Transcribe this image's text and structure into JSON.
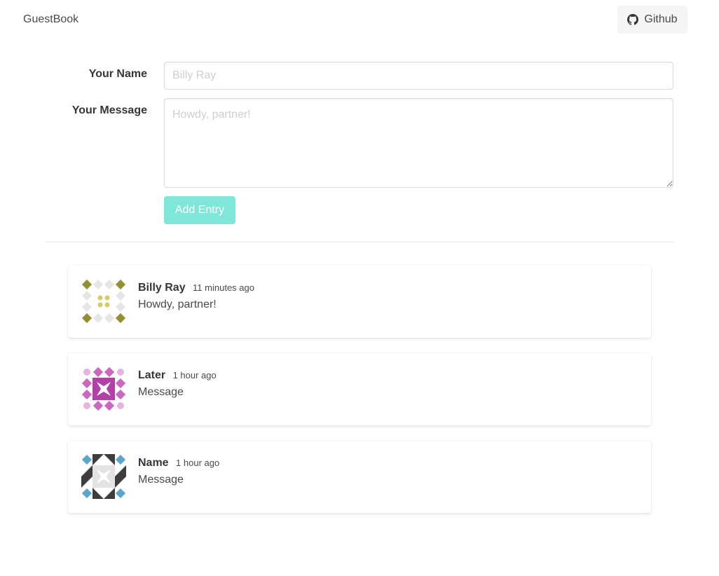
{
  "navbar": {
    "brand": "GuestBook",
    "github_label": "Github"
  },
  "form": {
    "name_label": "Your Name",
    "name_placeholder": "Billy Ray",
    "name_value": "",
    "message_label": "Your Message",
    "message_placeholder": "Howdy, partner!",
    "message_value": "",
    "submit_label": "Add Entry"
  },
  "colors": {
    "submit_button": "#7fe7d9",
    "github_button": "#f5f5f5"
  },
  "entries": [
    {
      "name": "Billy Ray",
      "time": "11 minutes ago",
      "message": "Howdy, partner!",
      "avatar_icon": "identicon-olive"
    },
    {
      "name": "Later",
      "time": "1 hour ago",
      "message": "Message",
      "avatar_icon": "identicon-magenta"
    },
    {
      "name": "Name",
      "time": "1 hour ago",
      "message": "Message",
      "avatar_icon": "identicon-blue"
    }
  ]
}
